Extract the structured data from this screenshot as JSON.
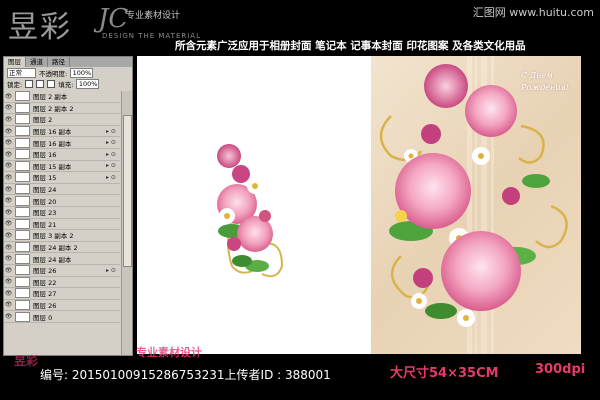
{
  "header": {
    "logo_main": "昱彩",
    "logo_jc": "JC",
    "logo_subtitle": "专业素材设计",
    "logo_en": "DESIGN THE MATERIAL",
    "site": "汇图网 www.huitu.com",
    "tagline": "所含元素广泛应用于相册封面  笔记本  记事本封面  印花图案  及各类文化用品"
  },
  "panel": {
    "tabs": [
      "图层",
      "通道",
      "路径"
    ],
    "blend_mode": "正常",
    "opacity_label": "不透明度:",
    "opacity_value": "100%",
    "lock_label": "锁定:",
    "fill_label": "填充:",
    "fill_value": "100%",
    "layers": [
      {
        "name": "图层 2 副本",
        "fx": ""
      },
      {
        "name": "图层 2 副本 2",
        "fx": ""
      },
      {
        "name": "图层 2",
        "fx": ""
      },
      {
        "name": "图层 16 副本",
        "fx": "▸ ⊙"
      },
      {
        "name": "图层 16 副本",
        "fx": "▸ ⊙"
      },
      {
        "name": "图层 16",
        "fx": "▸ ⊙"
      },
      {
        "name": "图层 15 副本",
        "fx": "▸ ⊙"
      },
      {
        "name": "图层 15",
        "fx": "▸ ⊙"
      },
      {
        "name": "图层 24",
        "fx": ""
      },
      {
        "name": "图层 20",
        "fx": ""
      },
      {
        "name": "图层 23",
        "fx": ""
      },
      {
        "name": "图层 21",
        "fx": ""
      },
      {
        "name": "图层 3 副本 2",
        "fx": ""
      },
      {
        "name": "图层 24 副本 2",
        "fx": ""
      },
      {
        "name": "图层 24 副本",
        "fx": ""
      },
      {
        "name": "图层 26",
        "fx": "▸ ⊙"
      },
      {
        "name": "图层 22",
        "fx": ""
      },
      {
        "name": "图层 27",
        "fx": ""
      },
      {
        "name": "图层 26",
        "fx": ""
      },
      {
        "name": "图层 0",
        "fx": ""
      }
    ]
  },
  "cover": {
    "greeting_line1": "С Днем",
    "greeting_line2": "Рождения!"
  },
  "footer": {
    "id_text": "编号: 20150100915286753231上传者ID : 388001",
    "overlay_red": "昱彩",
    "overlay_red2": "专业素材设计",
    "size": "大尺寸54×35CM",
    "dpi": "300dpi"
  },
  "colors": {
    "accent": "#e83a6a",
    "panel_bg": "#d4d0c8",
    "cover_bg": "#efdcc2"
  }
}
